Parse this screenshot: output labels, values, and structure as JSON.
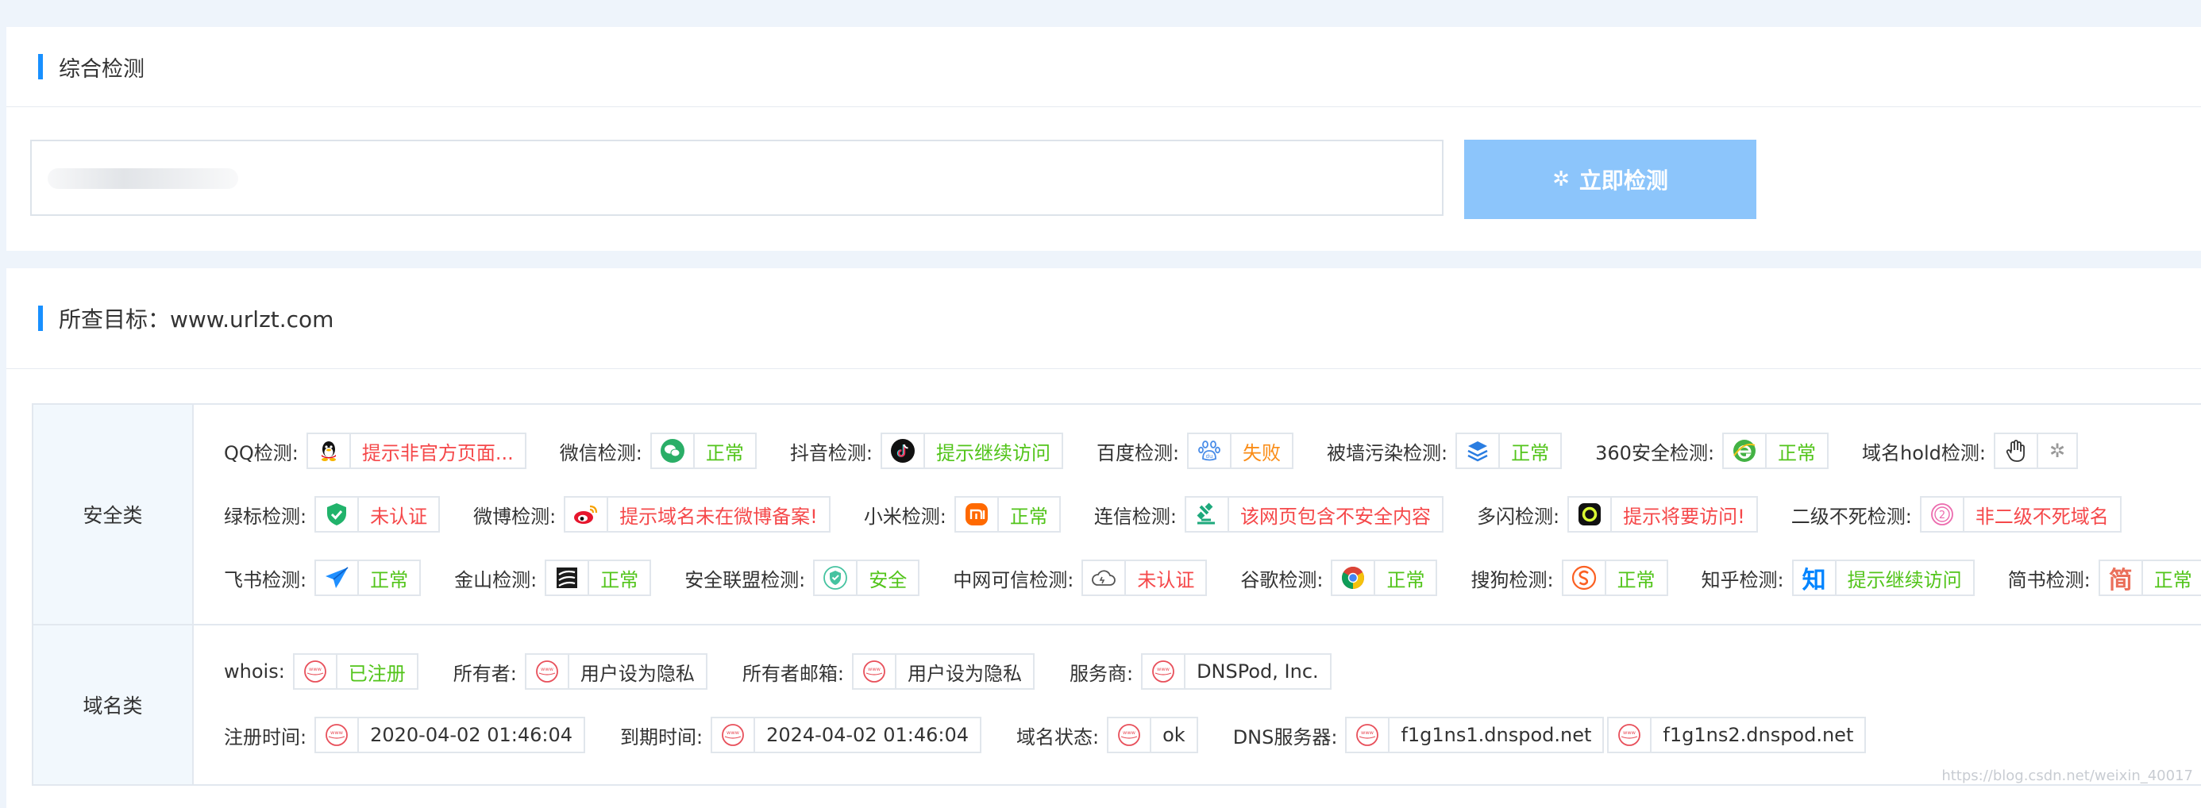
{
  "search_card": {
    "title": "综合检测",
    "button_label": "立即检测"
  },
  "result_card": {
    "title": "所查目标：www.urlzt.com"
  },
  "security": {
    "category": "安全类",
    "lines": [
      [
        {
          "label": "QQ检测:",
          "icon": "qq-penguin-icon",
          "status": "提示非官方页面...",
          "color": "red"
        },
        {
          "label": "微信检测:",
          "icon": "wechat-icon",
          "status": "正常",
          "color": "green"
        },
        {
          "label": "抖音检测:",
          "icon": "douyin-icon",
          "status": "提示继续访问",
          "color": "green"
        },
        {
          "label": "百度检测:",
          "icon": "baidu-paw-icon",
          "status": "失败",
          "color": "orange"
        },
        {
          "label": "被墙污染检测:",
          "icon": "layers-icon",
          "status": "正常",
          "color": "green"
        },
        {
          "label": "360安全检测:",
          "icon": "ie-360-icon",
          "status": "正常",
          "color": "green"
        },
        {
          "label": "域名hold检测:",
          "icon": "hand-stop-icon",
          "status": "",
          "color": "loading"
        }
      ],
      [
        {
          "label": "绿标检测:",
          "icon": "green-shield-icon",
          "status": "未认证",
          "color": "red"
        },
        {
          "label": "微博检测:",
          "icon": "weibo-icon",
          "status": "提示域名未在微博备案!",
          "color": "red"
        },
        {
          "label": "小米检测:",
          "icon": "xiaomi-icon",
          "status": "正常",
          "color": "green"
        },
        {
          "label": "连信检测:",
          "icon": "lianxin-icon",
          "status": "该网页包含不安全内容",
          "color": "red"
        },
        {
          "label": "多闪检测:",
          "icon": "duoshan-icon",
          "status": "提示将要访问!",
          "color": "red"
        },
        {
          "label": "二级不死检测:",
          "icon": "circle-two-icon",
          "status": "非二级不死域名",
          "color": "red"
        }
      ],
      [
        {
          "label": "飞书检测:",
          "icon": "feishu-plane-icon",
          "status": "正常",
          "color": "green"
        },
        {
          "label": "金山检测:",
          "icon": "kingsoft-icon",
          "status": "正常",
          "color": "green"
        },
        {
          "label": "安全联盟检测:",
          "icon": "security-alliance-icon",
          "status": "安全",
          "color": "green"
        },
        {
          "label": "中网可信检测:",
          "icon": "cloud-icon",
          "status": "未认证",
          "color": "red"
        },
        {
          "label": "谷歌检测:",
          "icon": "chrome-icon",
          "status": "正常",
          "color": "green"
        },
        {
          "label": "搜狗检测:",
          "icon": "sogou-icon",
          "status": "正常",
          "color": "green"
        },
        {
          "label": "知乎检测:",
          "icon": "zhihu-icon",
          "status": "提示继续访问",
          "color": "green",
          "icon_text": "知"
        },
        {
          "label": "简书检测:",
          "icon": "jianshu-icon",
          "status": "正常",
          "color": "green",
          "icon_text": "简"
        }
      ]
    ]
  },
  "domain": {
    "category": "域名类",
    "lines": [
      [
        {
          "label": "whois:",
          "icon": "www-icon",
          "status": "已注册",
          "color": "green"
        },
        {
          "label": "所有者:",
          "icon": "www-icon",
          "status": "用户设为隐私",
          "color": "black"
        },
        {
          "label": "所有者邮箱:",
          "icon": "www-icon",
          "status": "用户设为隐私",
          "color": "black"
        },
        {
          "label": "服务商:",
          "icon": "www-icon",
          "status": "DNSPod, Inc.",
          "color": "black"
        }
      ],
      [
        {
          "label": "注册时间:",
          "icon": "www-icon",
          "status": "2020-04-02 01:46:04",
          "color": "black"
        },
        {
          "label": "到期时间:",
          "icon": "www-icon",
          "status": "2024-04-02 01:46:04",
          "color": "black"
        },
        {
          "label": "域名状态:",
          "icon": "www-icon",
          "status": "ok",
          "color": "black"
        },
        {
          "label": "DNS服务器:",
          "icon": "www-icon",
          "status": "f1g1ns1.dnspod.net",
          "color": "black",
          "extra": "f1g1ns2.dnspod.net"
        }
      ]
    ]
  },
  "watermark": "https://blog.csdn.net/weixin_40017"
}
